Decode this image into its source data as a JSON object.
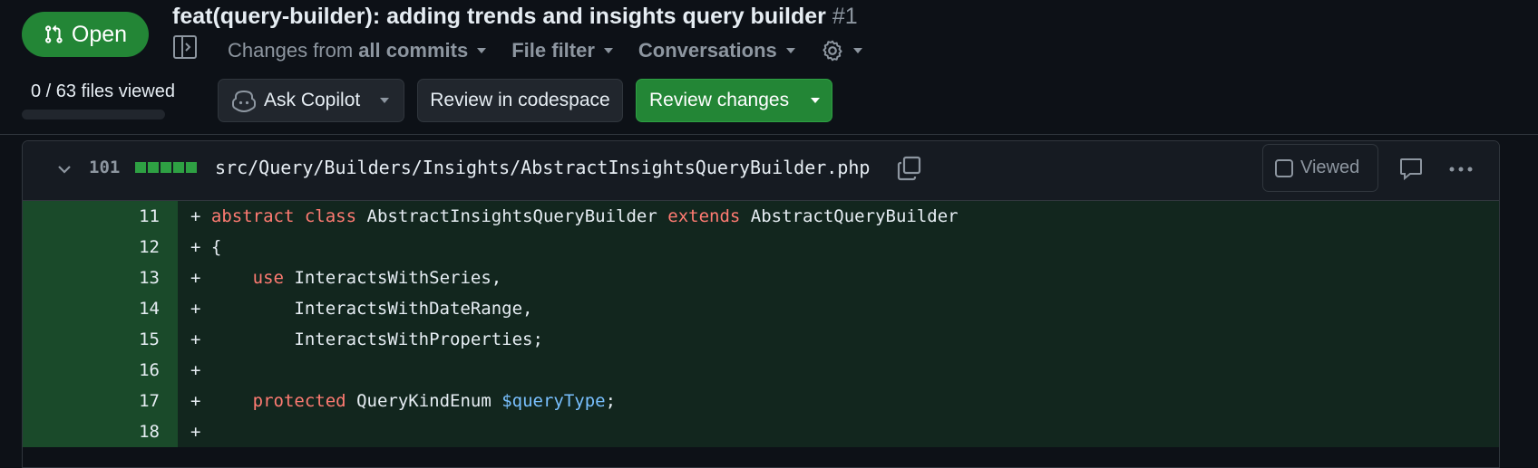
{
  "header": {
    "state_label": "Open",
    "title": "feat(query-builder): adding trends and insights query builder",
    "number": "#1",
    "nav": {
      "changes_prefix": "Changes from",
      "changes_value": "all commits",
      "file_filter": "File filter",
      "conversations": "Conversations"
    },
    "files_viewed": "0 / 63 files viewed",
    "files_viewed_progress": 0,
    "ask_copilot": "Ask Copilot",
    "review_in_codespace": "Review in codespace",
    "review_changes": "Review changes"
  },
  "file": {
    "line_count": "101",
    "path": "src/Query/Builders/Insights/AbstractInsightsQueryBuilder.php",
    "viewed_label": "Viewed"
  },
  "code_lines": [
    {
      "ln": "11",
      "prefix": "+ "
    },
    {
      "ln": "12",
      "prefix": "+ ",
      "text": "{"
    },
    {
      "ln": "13",
      "prefix": "+ "
    },
    {
      "ln": "14",
      "prefix": "+ ",
      "text": "        InteractsWithDateRange,"
    },
    {
      "ln": "15",
      "prefix": "+ ",
      "text": "        InteractsWithProperties;"
    },
    {
      "ln": "16",
      "prefix": "+ ",
      "text": ""
    },
    {
      "ln": "17",
      "prefix": "+ "
    },
    {
      "ln": "18",
      "prefix": "+ ",
      "text": ""
    }
  ],
  "line11": {
    "kw1": "abstract",
    "kw2": "class",
    "name": "AbstractInsightsQueryBuilder",
    "kw3": "extends",
    "parent": "AbstractQueryBuilder"
  },
  "line13": {
    "indent": "    ",
    "kw": "use",
    "rest": "InteractsWithSeries,"
  },
  "line17": {
    "indent": "    ",
    "kw": "protected",
    "type": "QueryKindEnum",
    "var": "$queryType",
    "end": ";"
  },
  "colors": {
    "accent_green": "#238636",
    "background": "#0d1117",
    "keyword": "#ff7b72",
    "variable": "#79c0ff"
  }
}
